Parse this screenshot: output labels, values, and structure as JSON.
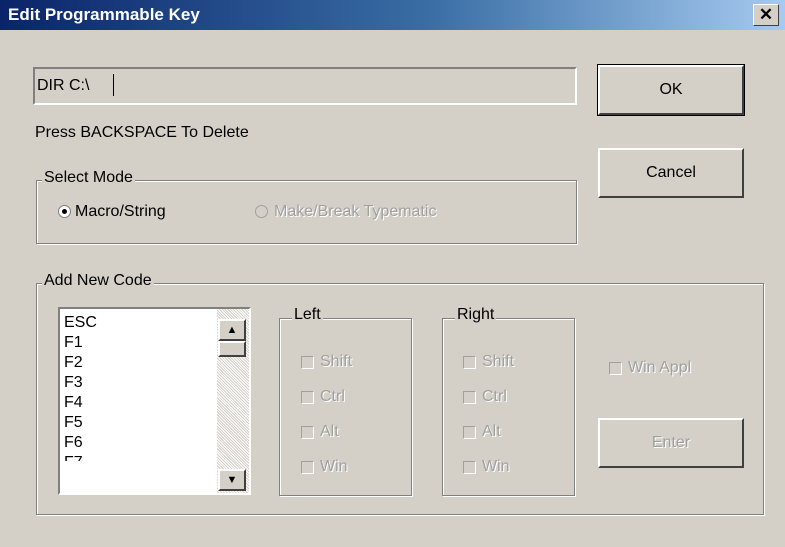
{
  "window": {
    "title": "Edit Programmable Key",
    "close_glyph": "✕"
  },
  "input": {
    "value": "DIR C:\\"
  },
  "hint": "Press BACKSPACE To Delete",
  "buttons": {
    "ok": "OK",
    "cancel": "Cancel",
    "enter": "Enter"
  },
  "select_mode": {
    "label": "Select Mode",
    "options": [
      {
        "label": "Macro/String",
        "selected": true,
        "enabled": true
      },
      {
        "label": "Make/Break Typematic",
        "selected": false,
        "enabled": false
      }
    ]
  },
  "add_new_code": {
    "label": "Add New Code",
    "codes": [
      "ESC",
      "F1",
      "F2",
      "F3",
      "F4",
      "F5",
      "F6"
    ],
    "left": {
      "label": "Left",
      "items": [
        "Shift",
        "Ctrl",
        "Alt",
        "Win"
      ]
    },
    "right": {
      "label": "Right",
      "items": [
        "Shift",
        "Ctrl",
        "Alt",
        "Win"
      ]
    },
    "win_appl": "Win Appl"
  }
}
